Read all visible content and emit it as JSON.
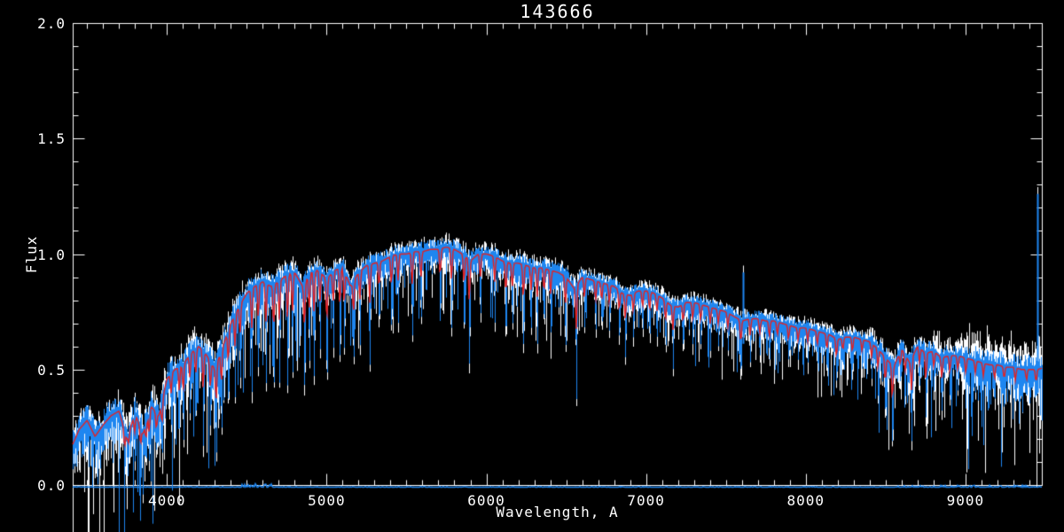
{
  "chart_data": {
    "type": "line",
    "title": "143666",
    "xlabel": "Wavelength, A",
    "ylabel": "Flux",
    "xlim": [
      3410,
      9478
    ],
    "ylim": [
      0.0,
      2.0
    ],
    "grid": false,
    "legend": "none",
    "x_minor_step": 100,
    "y_minor_step": 0.1,
    "x_ticks": [
      {
        "value": 4000,
        "label": "4000"
      },
      {
        "value": 5000,
        "label": "5000"
      },
      {
        "value": 6000,
        "label": "6000"
      },
      {
        "value": 7000,
        "label": "7000"
      },
      {
        "value": 8000,
        "label": "8000"
      },
      {
        "value": 9000,
        "label": "9000"
      }
    ],
    "y_ticks": [
      {
        "value": 0.0,
        "label": "0.0"
      },
      {
        "value": 0.5,
        "label": "0.5"
      },
      {
        "value": 1.0,
        "label": "1.0"
      },
      {
        "value": 1.5,
        "label": "1.5"
      },
      {
        "value": 2.0,
        "label": "2.0"
      }
    ],
    "colors": {
      "background": "#000000",
      "frame": "#ffffff",
      "observed": "#ffffff",
      "template": "#1e86f0",
      "model": "#e42222"
    },
    "series": [
      {
        "name": "observed-spectrum",
        "color_key": "observed",
        "style": "noisy line"
      },
      {
        "name": "template-spectrum",
        "color_key": "template",
        "style": "noisy line with deep absorption spikes"
      },
      {
        "name": "model-fit",
        "color_key": "model",
        "style": "smooth line"
      },
      {
        "name": "error-spectrum",
        "color_key": "template",
        "style": "flat line at zero flux along x-axis"
      }
    ],
    "continuum": {
      "wavelength": [
        3400,
        3450,
        3500,
        3550,
        3600,
        3650,
        3700,
        3750,
        3800,
        3850,
        3900,
        3950,
        4000,
        4050,
        4100,
        4150,
        4200,
        4250,
        4300,
        4350,
        4400,
        4450,
        4500,
        4550,
        4600,
        4650,
        4700,
        4750,
        4800,
        4850,
        4900,
        4950,
        5000,
        5050,
        5100,
        5150,
        5200,
        5250,
        5300,
        5350,
        5400,
        5450,
        5500,
        5550,
        5600,
        5650,
        5700,
        5750,
        5800,
        5850,
        5900,
        5950,
        6000,
        6050,
        6100,
        6150,
        6200,
        6250,
        6300,
        6350,
        6400,
        6450,
        6500,
        6550,
        6600,
        6650,
        6700,
        6750,
        6800,
        6850,
        6900,
        6950,
        7000,
        7050,
        7100,
        7150,
        7200,
        7250,
        7300,
        7350,
        7400,
        7450,
        7500,
        7550,
        7600,
        7650,
        7700,
        7750,
        7800,
        7850,
        7900,
        7950,
        8000,
        8050,
        8100,
        8150,
        8200,
        8250,
        8300,
        8350,
        8400,
        8450,
        8500,
        8550,
        8600,
        8650,
        8700,
        8750,
        8800,
        8850,
        8900,
        8950,
        9000,
        9050,
        9100,
        9150,
        9200,
        9250,
        9300,
        9350,
        9400,
        9450,
        9500
      ],
      "flux": [
        0.16,
        0.24,
        0.28,
        0.21,
        0.26,
        0.3,
        0.32,
        0.2,
        0.31,
        0.22,
        0.34,
        0.3,
        0.46,
        0.5,
        0.52,
        0.57,
        0.6,
        0.56,
        0.5,
        0.6,
        0.7,
        0.77,
        0.83,
        0.86,
        0.88,
        0.86,
        0.88,
        0.91,
        0.92,
        0.86,
        0.92,
        0.93,
        0.89,
        0.93,
        0.94,
        0.86,
        0.92,
        0.95,
        0.96,
        0.97,
        0.99,
        1.0,
        1.0,
        1.01,
        1.01,
        1.02,
        1.02,
        1.03,
        1.02,
        1.0,
        0.97,
        1.0,
        1.0,
        0.99,
        0.97,
        0.96,
        0.96,
        0.95,
        0.94,
        0.94,
        0.93,
        0.92,
        0.9,
        0.85,
        0.9,
        0.89,
        0.88,
        0.87,
        0.86,
        0.83,
        0.82,
        0.84,
        0.84,
        0.83,
        0.81,
        0.78,
        0.77,
        0.79,
        0.79,
        0.78,
        0.77,
        0.76,
        0.75,
        0.73,
        0.71,
        0.72,
        0.72,
        0.71,
        0.71,
        0.7,
        0.69,
        0.68,
        0.68,
        0.67,
        0.66,
        0.65,
        0.63,
        0.64,
        0.64,
        0.63,
        0.62,
        0.59,
        0.55,
        0.51,
        0.59,
        0.53,
        0.6,
        0.57,
        0.58,
        0.55,
        0.56,
        0.56,
        0.55,
        0.54,
        0.53,
        0.52,
        0.52,
        0.51,
        0.51,
        0.5,
        0.5,
        0.5,
        0.51
      ]
    },
    "absorption_lines": [
      [
        3735,
        0.05
      ],
      [
        3760,
        0.12
      ],
      [
        3798,
        0.1
      ],
      [
        3835,
        0.06
      ],
      [
        3869,
        0.1
      ],
      [
        3889,
        0.09
      ],
      [
        3934,
        0.13
      ],
      [
        3969,
        0.12
      ],
      [
        4026,
        0.26
      ],
      [
        4077,
        0.24
      ],
      [
        4102,
        0.22
      ],
      [
        4144,
        0.3
      ],
      [
        4180,
        0.3
      ],
      [
        4227,
        0.16
      ],
      [
        4272,
        0.24
      ],
      [
        4308,
        0.12
      ],
      [
        4341,
        0.22
      ],
      [
        4384,
        0.32
      ],
      [
        4426,
        0.38
      ],
      [
        4458,
        0.45
      ],
      [
        4531,
        0.4
      ],
      [
        4572,
        0.48
      ],
      [
        4620,
        0.44
      ],
      [
        4668,
        0.38
      ],
      [
        4704,
        0.44
      ],
      [
        4755,
        0.4
      ],
      [
        4786,
        0.48
      ],
      [
        4861,
        0.38
      ],
      [
        4891,
        0.52
      ],
      [
        4921,
        0.46
      ],
      [
        4958,
        0.58
      ],
      [
        5001,
        0.42
      ],
      [
        5041,
        0.58
      ],
      [
        5083,
        0.52
      ],
      [
        5110,
        0.58
      ],
      [
        5168,
        0.52
      ],
      [
        5208,
        0.6
      ],
      [
        5270,
        0.52
      ],
      [
        5328,
        0.68
      ],
      [
        5405,
        0.66
      ],
      [
        5447,
        0.7
      ],
      [
        5535,
        0.63
      ],
      [
        5590,
        0.7
      ],
      [
        5711,
        0.72
      ],
      [
        5782,
        0.66
      ],
      [
        5860,
        0.68
      ],
      [
        5893,
        0.5
      ],
      [
        5962,
        0.72
      ],
      [
        6052,
        0.7
      ],
      [
        6122,
        0.62
      ],
      [
        6162,
        0.68
      ],
      [
        6232,
        0.58
      ],
      [
        6280,
        0.68
      ],
      [
        6318,
        0.6
      ],
      [
        6361,
        0.68
      ],
      [
        6402,
        0.66
      ],
      [
        6495,
        0.58
      ],
      [
        6563,
        0.37
      ],
      [
        6614,
        0.68
      ],
      [
        6684,
        0.66
      ],
      [
        6722,
        0.68
      ],
      [
        6770,
        0.66
      ],
      [
        6832,
        0.62
      ],
      [
        6870,
        0.54
      ],
      [
        6920,
        0.63
      ],
      [
        6978,
        0.66
      ],
      [
        7022,
        0.63
      ],
      [
        7068,
        0.64
      ],
      [
        7122,
        0.58
      ],
      [
        7168,
        0.5
      ],
      [
        7232,
        0.58
      ],
      [
        7292,
        0.6
      ],
      [
        7342,
        0.6
      ],
      [
        7402,
        0.58
      ],
      [
        7452,
        0.6
      ],
      [
        7512,
        0.58
      ],
      [
        7593,
        0.46
      ],
      [
        7652,
        0.53
      ],
      [
        7712,
        0.56
      ],
      [
        7772,
        0.53
      ],
      [
        7822,
        0.56
      ],
      [
        7892,
        0.53
      ],
      [
        7952,
        0.54
      ],
      [
        8012,
        0.53
      ],
      [
        8072,
        0.52
      ],
      [
        8132,
        0.48
      ],
      [
        8192,
        0.43
      ],
      [
        8232,
        0.5
      ],
      [
        8292,
        0.48
      ],
      [
        8352,
        0.5
      ],
      [
        8412,
        0.46
      ],
      [
        8452,
        0.38
      ],
      [
        8498,
        0.28
      ],
      [
        8542,
        0.14
      ],
      [
        8592,
        0.43
      ],
      [
        8622,
        0.38
      ],
      [
        8662,
        0.19
      ],
      [
        8712,
        0.43
      ],
      [
        8752,
        0.28
      ],
      [
        8802,
        0.4
      ],
      [
        8852,
        0.31
      ],
      [
        8902,
        0.38
      ],
      [
        8952,
        0.4
      ],
      [
        9002,
        0.38
      ],
      [
        9062,
        0.4
      ],
      [
        9112,
        0.38
      ],
      [
        9182,
        0.36
      ],
      [
        9242,
        0.38
      ],
      [
        9312,
        0.36
      ],
      [
        9382,
        0.38
      ],
      [
        9442,
        0.36
      ]
    ],
    "emission_spikes": [
      [
        7608,
        0.92
      ],
      [
        9450,
        1.26
      ]
    ],
    "noise": {
      "seed": 7
    }
  }
}
